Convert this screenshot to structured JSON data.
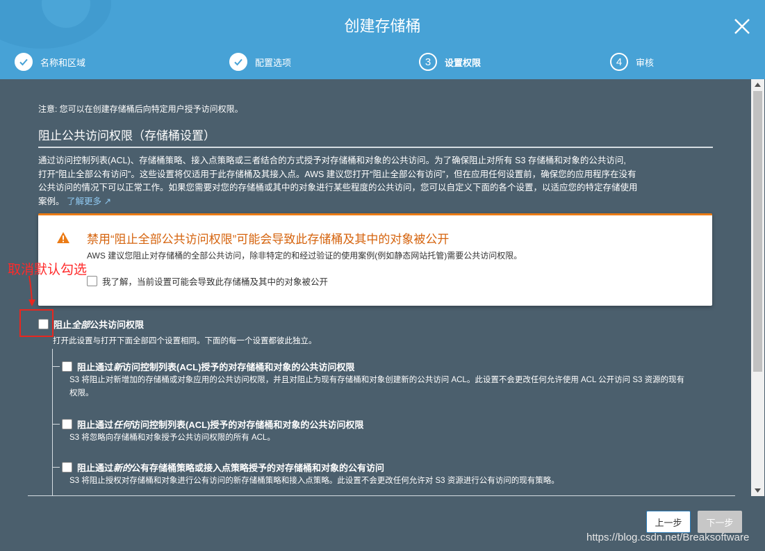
{
  "dialog": {
    "title": "创建存储桶"
  },
  "steps": [
    {
      "label": "名称和区域",
      "marker": "✓",
      "state": "done"
    },
    {
      "label": "配置选项",
      "marker": "✓",
      "state": "done"
    },
    {
      "label": "设置权限",
      "marker": "3",
      "state": "active"
    },
    {
      "label": "审核",
      "marker": "4",
      "state": "pending"
    }
  ],
  "content": {
    "note": "注意: 您可以在创建存储桶后向特定用户授予访问权限。",
    "section_title": "阻止公共访问权限（存储桶设置）",
    "description_line1": "通过访问控制列表(ACL)、存储桶策略、接入点策略或三者结合的方式授予对存储桶和对象的公共访问。为了确保阻止对所有 S3 存储桶和对象的公共访问,",
    "description_line2": "打开“阻止全部公有访问”。这些设置将仅适用于此存储桶及其接入点。AWS 建议您打开“阻止全部公有访问”，但在应用任何设置前，确保您的应用程序在没有",
    "description_line3": "公共访问的情况下可以正常工作。如果您需要对您的存储桶或其中的对象进行某些程度的公共访问，您可以自定义下面的各个设置，以适应您的特定存储使用",
    "description_line4": "案例。",
    "learn_more": "了解更多"
  },
  "warning": {
    "title": "禁用“阻止全部公共访问权限”可能会导致此存储桶及其中的对象被公开",
    "text": "AWS 建议您阻止对存储桶的全部公共访问，除非特定的和经过验证的使用案例(例如静态网站托管)需要公共访问权限。",
    "acknowledge": "我了解，当前设置可能会导致此存储桶及其中的对象被公开",
    "accent_color": "#eb7b16"
  },
  "options": {
    "block_all": {
      "label_pre": "阻止",
      "label_em": "全部",
      "label_post": "公共访问权限",
      "desc": "打开此设置与打开下面全部四个设置相同。下面的每一个设置都彼此独立。",
      "checked": false
    },
    "sub": [
      {
        "label_pre": "阻止通过",
        "label_em": "新",
        "label_post": "访问控制列表(ACL)授予的对存储桶和对象的公共访问权限",
        "desc_line1": "S3 将阻止对新增加的存储桶或对象应用的公共访问权限，并且对阻止为现有存储桶和对象创建新的公共访问 ACL。此设置不会更改任何允许使用 ACL 公开访问 S3 资源的现有",
        "desc_line2": "权限。"
      },
      {
        "label_pre": "阻止通过",
        "label_em": "任何",
        "label_post": "访问控制列表(ACL)授予的对存储桶和对象的公共访问权限",
        "desc_line1": "S3 将忽略向存储桶和对象授予公共访问权限的所有 ACL。",
        "desc_line2": ""
      },
      {
        "label_pre": "阻止通过",
        "label_em": "新的",
        "label_post": "公有存储桶策略或接入点策略授予的对存储桶和对象的公有访问",
        "desc_line1": "S3 将阻止授权对存储桶和对象进行公有访问的新存储桶策略和接入点策略。此设置不会更改任何允许对 S3 资源进行公有访问的现有策略。",
        "desc_line2": ""
      }
    ]
  },
  "footer": {
    "prev_label": "上一步",
    "next_label": "下一步"
  },
  "annotation": {
    "text": "取消默认勾选",
    "color": "#ff2a2a"
  },
  "watermark": "https://blog.csdn.net/Breaksoftware"
}
